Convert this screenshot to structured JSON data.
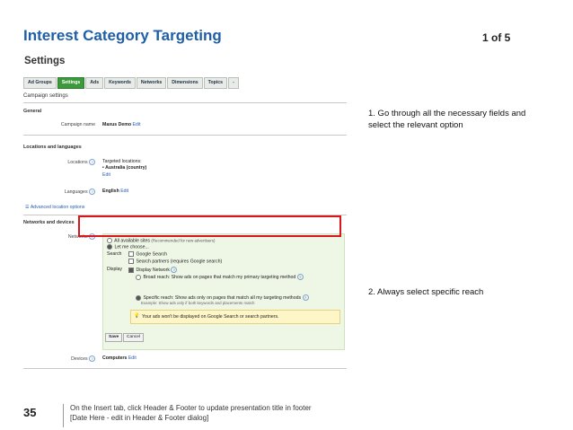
{
  "slide": {
    "title": "Interest Category Targeting",
    "page_indicator": "1 of 5",
    "subtitle": "Settings",
    "slide_number": "35",
    "footer_line1": "On the Insert tab, click Header & Footer to update presentation title in footer",
    "footer_line2": "[Date Here - edit in Header & Footer dialog]"
  },
  "annotations": {
    "step1": "1. Go through all the necessary fields and select the relevant option",
    "step2": "2. Always select specific reach"
  },
  "screenshot": {
    "tabs": [
      {
        "label": "Ad Groups"
      },
      {
        "label": "Settings",
        "active": true
      },
      {
        "label": "Ads"
      },
      {
        "label": "Keywords"
      },
      {
        "label": "Networks"
      },
      {
        "label": "Dimensions"
      },
      {
        "label": "Topics"
      },
      {
        "label": "-"
      }
    ],
    "page_heading": "Campaign settings",
    "general": {
      "heading": "General",
      "campaign_name_label": "Campaign name",
      "campaign_name_value": "Maxus Demo",
      "edit": "Edit"
    },
    "locations": {
      "heading": "Locations and languages",
      "locations_label": "Locations",
      "targeted_label": "Targeted locations:",
      "targeted_value": "Australia (country)",
      "edit": "Edit",
      "languages_label": "Languages",
      "languages_value": "English",
      "languages_edit": "Edit",
      "advanced_link": "Advanced location options"
    },
    "networks": {
      "heading": "Networks and devices",
      "networks_label": "Networks",
      "all_sites": "All available sites",
      "all_sites_note": "(Recommended for new advertisers)",
      "let_me_choose": "Let me choose...",
      "search_label": "Search",
      "google_search": "Google Search",
      "search_partners": "Search partners (requires Google search)",
      "display_label": "Display",
      "display_network": "Display Network",
      "broad_reach": "Broad reach: Show ads on pages that match my primary targeting method",
      "specific_reach": "Specific reach: Show ads only on pages that match all my targeting methods",
      "specific_example": "Example: Show ads only if both keywords and placements match",
      "warning": "Your ads won't be displayed on Google Search or search partners.",
      "save": "Save",
      "cancel": "Cancel",
      "devices_label": "Devices",
      "devices_value": "Computers",
      "devices_edit": "Edit"
    }
  }
}
